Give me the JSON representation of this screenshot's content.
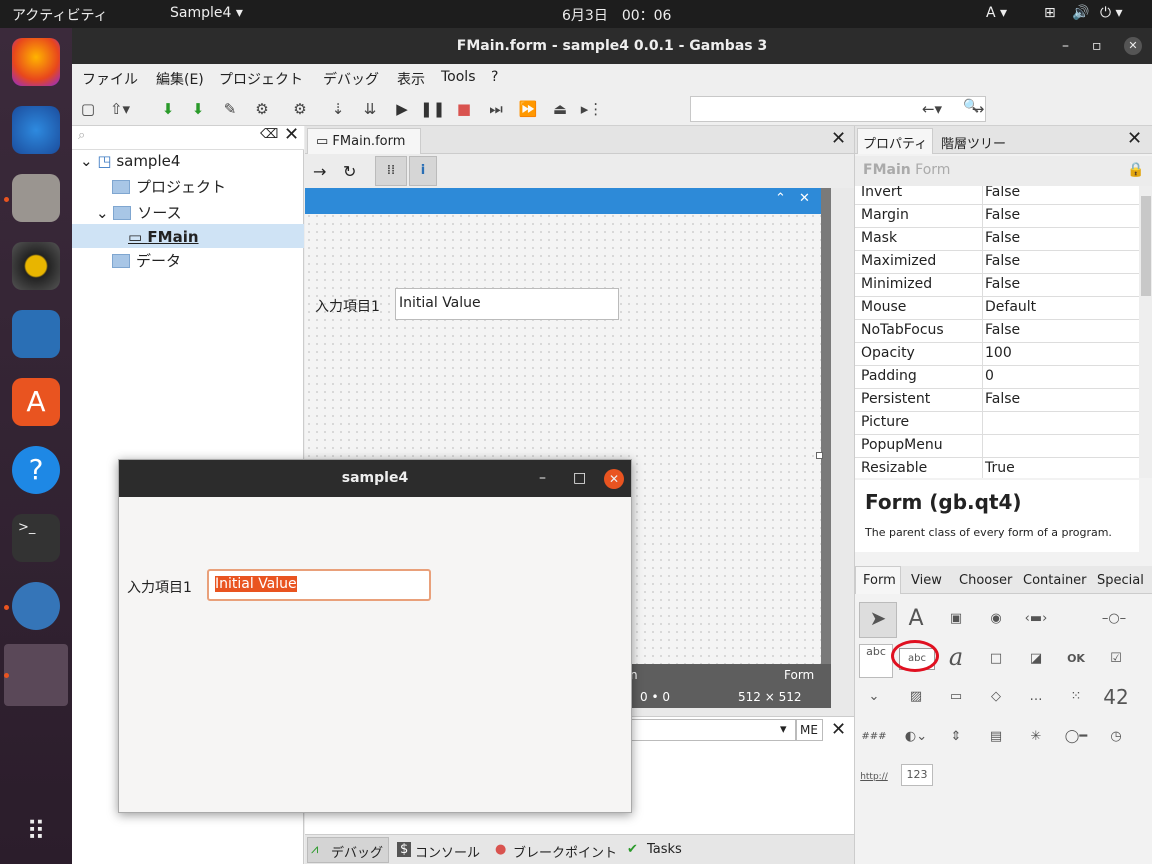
{
  "topbar": {
    "activities": "アクティビティ",
    "app": "Sample4 ▾",
    "clock": "6月3日　00：06",
    "input": "A ▾"
  },
  "window": {
    "title": "FMain.form - sample4 0.0.1 - Gambas 3"
  },
  "menu": [
    "ファイル",
    "編集(E)",
    "プロジェクト",
    "デバッグ",
    "表示",
    "Tools",
    "?"
  ],
  "tree": {
    "root": "sample4",
    "project": "プロジェクト",
    "source": "ソース",
    "fmain": "FMain",
    "data": "データ"
  },
  "editor": {
    "tab": "FMain.form",
    "label": "入力項目1",
    "value": "Initial Value",
    "status_right": "Form",
    "status_pos": "0 • 0",
    "status_size": "512 × 512",
    "status_left": "n"
  },
  "props": {
    "tab1": "プロパティ",
    "tab2": "階層ツリー",
    "header_name": "FMain",
    "header_class": "Form",
    "rows": [
      [
        "Invert",
        "False"
      ],
      [
        "Margin",
        "False"
      ],
      [
        "Mask",
        "False"
      ],
      [
        "Maximized",
        "False"
      ],
      [
        "Minimized",
        "False"
      ],
      [
        "Mouse",
        "Default"
      ],
      [
        "NoTabFocus",
        "False"
      ],
      [
        "Opacity",
        "100"
      ],
      [
        "Padding",
        "0"
      ],
      [
        "Persistent",
        "False"
      ],
      [
        "Picture",
        ""
      ],
      [
        "PopupMenu",
        ""
      ],
      [
        "Resizable",
        "True"
      ]
    ],
    "help_title": "Form (gb.qt4)",
    "help_text": "The parent class of every form of a program."
  },
  "toolbox": {
    "tabs": [
      "Form",
      "View",
      "Chooser",
      "Container",
      "Special"
    ],
    "ok": "OK",
    "abc": "abc",
    "num": "123",
    "http": "http://",
    "hash": "###"
  },
  "dialog": {
    "title": "sample4",
    "label": "入力項目1",
    "value": "Initial Value"
  },
  "bottom": {
    "debug": "デバッグ",
    "console": "コンソール",
    "breakpoint": "ブレークポイント",
    "tasks": "Tasks",
    "me": "ME"
  }
}
